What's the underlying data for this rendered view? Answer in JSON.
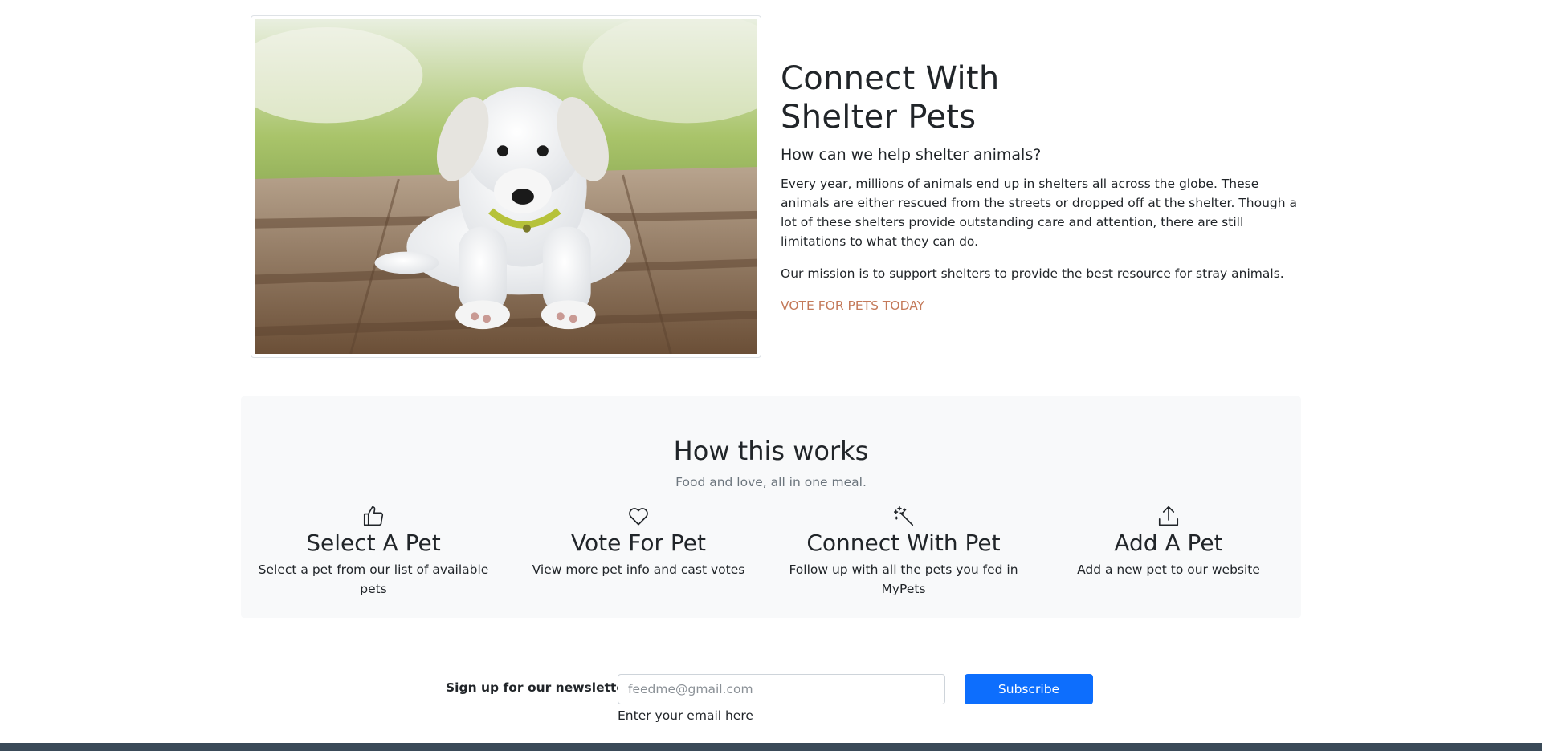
{
  "hero": {
    "image_alt": "white puppy lying on wooden deck",
    "title_line1": "Connect With",
    "title_line2": "Shelter Pets",
    "subtitle": "How can we help shelter animals?",
    "paragraph1": "Every year, millions of animals end up in shelters all across the globe. These animals are either rescued from the streets or dropped off at the shelter. Though a lot of these shelters provide outstanding care and attention, there are still limitations to what they can do.",
    "paragraph2": "Our mission is to support shelters to provide the best resource for stray animals.",
    "cta": "Vote for pets today",
    "cta_color": "#c47a5a"
  },
  "how_it_works": {
    "title": "How this works",
    "subtitle": "Food and love, all in one meal.",
    "features": [
      {
        "icon": "thumbs-up-icon",
        "title": "Select A Pet",
        "description": "Select a pet from our list of available pets"
      },
      {
        "icon": "heart-icon",
        "title": "Vote For Pet",
        "description": "View more pet info and cast votes"
      },
      {
        "icon": "magic-wand-icon",
        "title": "Connect With Pet",
        "description": "Follow up with all the pets you fed in MyPets"
      },
      {
        "icon": "upload-icon",
        "title": "Add A Pet",
        "description": "Add a new pet to our website"
      }
    ]
  },
  "newsletter": {
    "label": "Sign up for our newsletter",
    "email_placeholder": "feedme@gmail.com",
    "email_value": "",
    "help_text": "Enter your email here",
    "subscribe_label": "Subscribe",
    "button_color": "#0d6efd"
  },
  "colors": {
    "section_bg": "#f8f9fa",
    "footer": "#3a4a58"
  }
}
